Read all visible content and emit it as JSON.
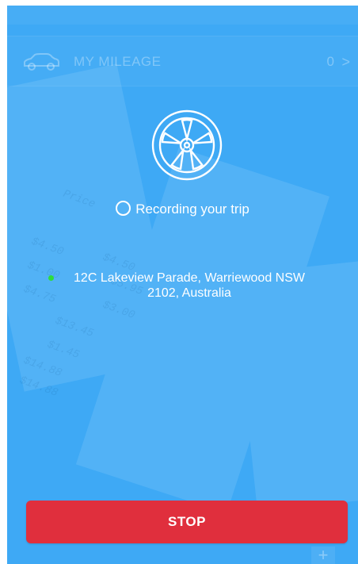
{
  "header": {
    "title": "MY MILEAGE",
    "count": "0",
    "chevron": ">",
    "icon": "car-icon"
  },
  "tracking": {
    "icon": "wheel-icon",
    "status_text": "Recording your trip",
    "location": "12C Lakeview Parade, Warriewood NSW 2102, Australia",
    "location_dot_color": "#2ddc3c"
  },
  "actions": {
    "stop_label": "STOP",
    "add_icon": "plus-icon",
    "add_glyph": "+"
  },
  "colors": {
    "background": "#3ea9f5",
    "stop_button": "#e02f3d"
  }
}
